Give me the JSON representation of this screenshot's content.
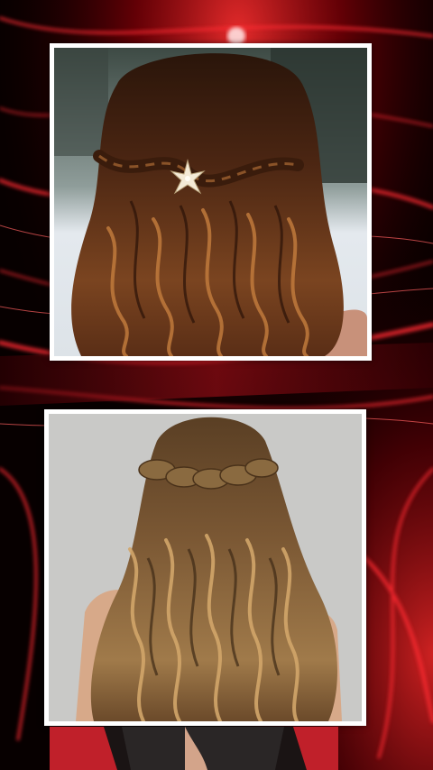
{
  "background": {
    "base_color": "#050000",
    "accent_color": "#e0101a",
    "glow_color": "#ff4040"
  },
  "photos": [
    {
      "subject": "hair-photo",
      "hair_color": "#5a2e16",
      "highlight_color": "#c07a3c",
      "backdrop_color": "#dde3e8",
      "accessory": "star-hair-clip"
    },
    {
      "subject": "hair-photo",
      "hair_color": "#6b4a2a",
      "highlight_color": "#d2a66a",
      "backdrop_color": "#c9c9c7",
      "accessory": "braided-crown"
    }
  ]
}
